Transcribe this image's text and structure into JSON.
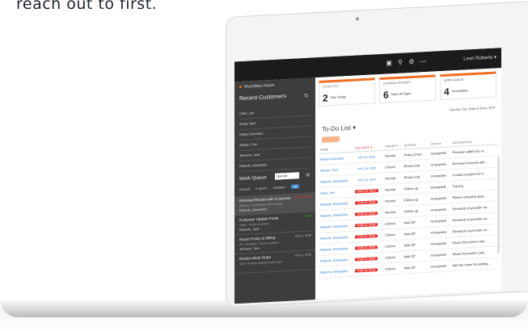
{
  "caption": "reach out to first.",
  "topbar": {
    "icons": [
      "briefcase-icon",
      "search-icon",
      "gear-icon",
      "menu-icon"
    ],
    "user": "Leon Roberts ▾"
  },
  "sidebar": {
    "brand": "MyUtilities Notes",
    "recent_title": "Recent Customers",
    "recent": [
      "Clark, Joe",
      "Smith, Beth",
      "Rafael Gonzalez",
      "Altman, Tom",
      "Johnson, Jack",
      "Roberts, Alexandra"
    ],
    "work_queue": {
      "title": "Work Queue",
      "selected": "Special",
      "tabs": [
        "Unread",
        "In-given",
        "Updated",
        "All"
      ],
      "items": [
        {
          "title": "Renewal Review with Customer",
          "sub": "Delivery - Customers with renewal",
          "name": "Roberts, Alexandra",
          "date": "1 HOUR AGO",
          "date_color": "#e8342f"
        },
        {
          "title": "Customer Update Portal",
          "sub": "Tasks · Portal to update",
          "name": "Roberts, Jack",
          "date": "1 HR",
          "date_color": "#3fbf3f"
        },
        {
          "title": "Export Policy to Billing",
          "sub": "IPC, Disability - Policy Updated",
          "name": "Johnson, Tom",
          "date": "AUG 1, 2018",
          "date_color": "#bbbbbb"
        },
        {
          "title": "Review Work Order",
          "sub": "Task - Review updated work order",
          "name": "",
          "date": "AUG 1, 2018",
          "date_color": "#bbbbbb"
        }
      ]
    }
  },
  "cards": [
    {
      "label": "TO-DO LIST",
      "num": "2",
      "text": "Due Today"
    },
    {
      "label": "EXPIRING POLICIES",
      "num": "6",
      "text": "Next 30 Days"
    },
    {
      "label": "WORK QUEUE",
      "num": "4",
      "text": "Incomplete"
    }
  ],
  "main": {
    "sort_by": "Sort By: Due Date ▾   Show: All ▾",
    "todo_title": "To-Do List ▾",
    "columns": [
      "NAME",
      "DUE DATE ▼",
      "PRIORITY",
      "REASON",
      "STATUS",
      "DESCRIPTION"
    ],
    "rows": [
      [
        "Rafael Gonzalez",
        "SEP 16, 2018",
        "Normal",
        "Policy Chan...",
        "Incomplete",
        "Premium added for re..."
      ],
      [
        "Altman, Tom",
        "AUG 15, 2018",
        "Critical",
        "Phone Call",
        "Incomplete",
        "Renewal received with..."
      ],
      [
        "Roberts, Alexandra",
        "AUG 15, 2018",
        "Normal",
        "Phone Call",
        "Incomplete",
        "Contact prospect to d..."
      ],
      [
        "Clark, Joe",
        "AUG 15, 2018",
        "Normal",
        "Follow-up",
        "Incomplete",
        "Tracing"
      ],
      [
        "Roberts, Alexandra",
        "JUN 04, 2018",
        "Normal",
        "Follow-up",
        "Incomplete",
        "Please complete appr..."
      ],
      [
        "Roberts, Alexandra",
        "JUN 01, 2018",
        "Normal",
        "Follow-up",
        "Incomplete",
        "Demands of provider on..."
      ],
      [
        "Roberts, Alexandra",
        "FEB 04, 2018",
        "Critical",
        "Mail Off",
        "Incomplete",
        "Demands of provider on..."
      ],
      [
        "Roberts, Alexandra",
        "FEB 04, 2018",
        "Critical",
        "Mail Off",
        "Incomplete",
        "Demands of provider on..."
      ],
      [
        "Roberts, Alexandra",
        "FEB 04, 2018",
        "Critical",
        "Mail Off",
        "Incomplete",
        "Share Document Linki..."
      ],
      [
        "Roberts, Alexandra",
        "FEB 04, 2018",
        "Critical",
        "Mail Off",
        "Incomplete",
        "Share Document Linki..."
      ],
      [
        "Roberts, Alexandra",
        "FEB 04, 2018",
        "Critical",
        "Mail Off",
        "Incomplete",
        "Add the name for adding..."
      ]
    ],
    "overdue_from_row": 3
  },
  "colors": {
    "accent": "#f26f21",
    "link": "#2b7bd0",
    "overdue": "#e8342f",
    "topbar": "#1b1b1b",
    "sidebar": "#3d3d3d"
  }
}
